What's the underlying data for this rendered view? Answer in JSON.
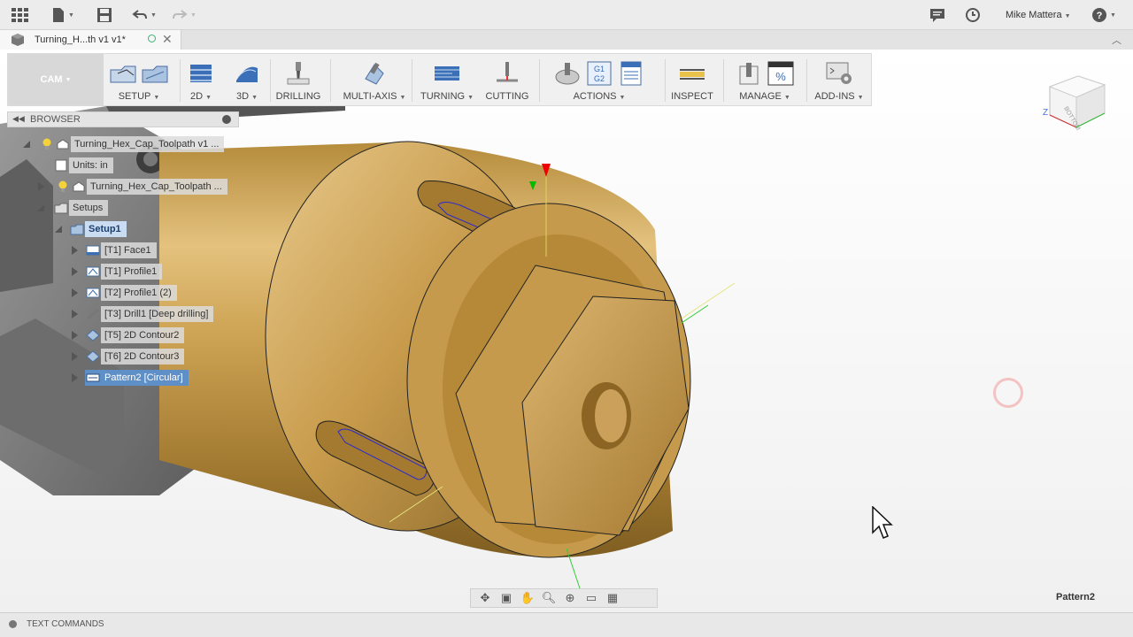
{
  "app": {
    "user_name": "Mike Mattera",
    "document_tab_title": "Turning_H...th v1 v1*"
  },
  "toolbar": {
    "workspace": "CAM",
    "groups": [
      {
        "label": "SETUP",
        "dropdown": true
      },
      {
        "label": "2D",
        "dropdown": true
      },
      {
        "label": "3D",
        "dropdown": true
      },
      {
        "label": "DRILLING",
        "dropdown": false
      },
      {
        "label": "MULTI-AXIS",
        "dropdown": true
      },
      {
        "label": "TURNING",
        "dropdown": true
      },
      {
        "label": "CUTTING",
        "dropdown": false
      },
      {
        "label": "ACTIONS",
        "dropdown": true
      },
      {
        "label": "INSPECT",
        "dropdown": false
      },
      {
        "label": "MANAGE",
        "dropdown": true
      },
      {
        "label": "ADD-INS",
        "dropdown": true
      }
    ],
    "actions_icon_text": [
      "G1",
      "G2"
    ],
    "manage_icon_text": "%"
  },
  "browser": {
    "title": "BROWSER",
    "items": [
      {
        "label": "Turning_Hex_Cap_Toolpath v1 ..."
      },
      {
        "label": "Units: in"
      },
      {
        "label": "Turning_Hex_Cap_Toolpath ..."
      },
      {
        "label": "Setups"
      },
      {
        "label": "Setup1"
      },
      {
        "label": "[T1] Face1"
      },
      {
        "label": "[T1] Profile1"
      },
      {
        "label": "[T2] Profile1 (2)"
      },
      {
        "label": "[T3] Drill1 [Deep drilling]"
      },
      {
        "label": "[T5] 2D Contour2"
      },
      {
        "label": "[T6] 2D Contour3"
      },
      {
        "label": "Pattern2 [Circular]"
      }
    ]
  },
  "viewcube": {
    "label": "BOTTOM",
    "axis": "Z"
  },
  "status": {
    "selection_label": "Pattern2"
  },
  "text_commands": {
    "label": "TEXT COMMANDS"
  },
  "colors": {
    "accent": "#5f8fc7",
    "part": "#c9a04e",
    "toolpath": "#2a2ad0"
  }
}
